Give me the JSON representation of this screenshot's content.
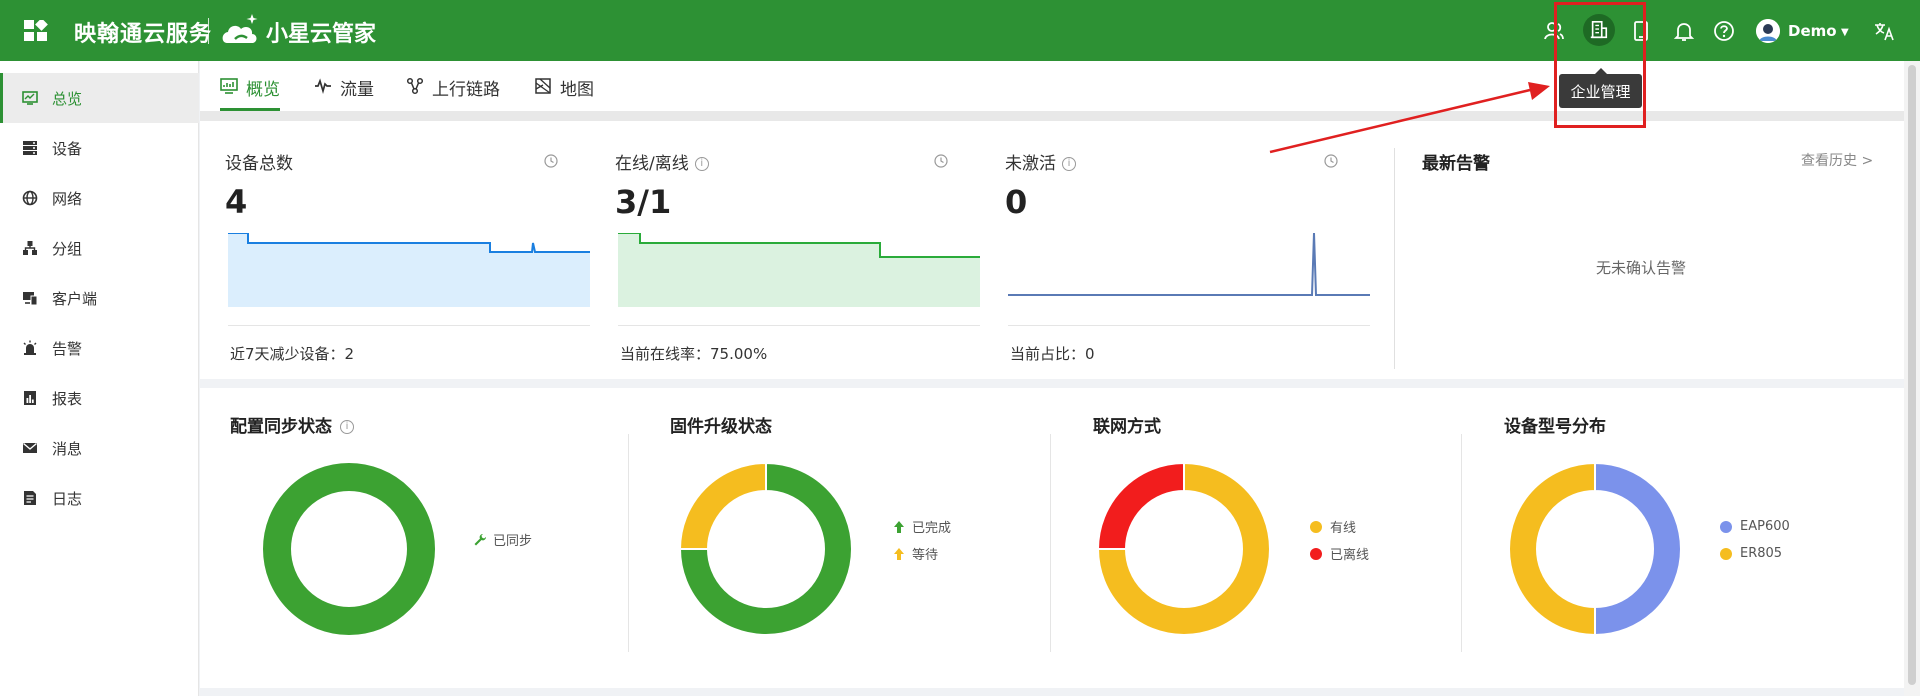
{
  "header": {
    "brand": "映翰通云服务",
    "product": "小星云管家",
    "user": "Demo",
    "icons": [
      "members-icon",
      "enterprise-icon",
      "device-icon",
      "bell-icon",
      "help-icon",
      "avatar",
      "translate-icon"
    ],
    "tooltip": "企业管理"
  },
  "sidebar": {
    "items": [
      {
        "label": "总览",
        "icon": "dashboard-icon"
      },
      {
        "label": "设备",
        "icon": "server-icon"
      },
      {
        "label": "网络",
        "icon": "globe-icon"
      },
      {
        "label": "分组",
        "icon": "group-icon"
      },
      {
        "label": "客户端",
        "icon": "client-icon"
      },
      {
        "label": "告警",
        "icon": "alarm-icon"
      },
      {
        "label": "报表",
        "icon": "report-icon"
      },
      {
        "label": "消息",
        "icon": "mail-icon"
      },
      {
        "label": "日志",
        "icon": "log-icon"
      }
    ]
  },
  "tabs": [
    {
      "label": "概览",
      "icon": "overview-icon"
    },
    {
      "label": "流量",
      "icon": "pulse-icon"
    },
    {
      "label": "上行链路",
      "icon": "uplink-icon"
    },
    {
      "label": "地图",
      "icon": "map-icon"
    }
  ],
  "stats": {
    "total": {
      "label": "设备总数",
      "value": "4",
      "foot": "近7天减少设备：2"
    },
    "online": {
      "label": "在线/离线",
      "value": "3/1",
      "foot": "当前在线率：75.00%"
    },
    "inactive": {
      "label": "未激活",
      "value": "0",
      "foot": "当前占比：0"
    }
  },
  "alarms": {
    "title": "最新告警",
    "history": "查看历史 >",
    "empty": "无未确认告警"
  },
  "donuts": {
    "config_sync": {
      "title": "配置同步状态",
      "legend": [
        "已同步"
      ]
    },
    "firmware": {
      "title": "固件升级状态",
      "legend": [
        "已完成",
        "等待"
      ]
    },
    "network": {
      "title": "联网方式",
      "legend": [
        "有线",
        "已离线"
      ]
    },
    "model": {
      "title": "设备型号分布",
      "legend": [
        "EAP600",
        "ER805"
      ]
    }
  },
  "colors": {
    "primary": "#2d9134",
    "blue": "#1a7fe0",
    "green_line": "#2aab3a",
    "donut_green": "#3ca232",
    "donut_yellow": "#f5bd1f",
    "donut_red": "#f21d1d",
    "donut_blue": "#7b92eb",
    "annotation_red": "#e02020"
  },
  "chart_data": [
    {
      "type": "pie",
      "title": "配置同步状态",
      "categories": [
        "已同步"
      ],
      "values": [
        4
      ]
    },
    {
      "type": "pie",
      "title": "固件升级状态",
      "categories": [
        "已完成",
        "等待"
      ],
      "values": [
        3,
        1
      ]
    },
    {
      "type": "pie",
      "title": "联网方式",
      "categories": [
        "有线",
        "已离线"
      ],
      "values": [
        3,
        1
      ]
    },
    {
      "type": "pie",
      "title": "设备型号分布",
      "categories": [
        "EAP600",
        "ER805"
      ],
      "values": [
        2,
        2
      ]
    }
  ]
}
